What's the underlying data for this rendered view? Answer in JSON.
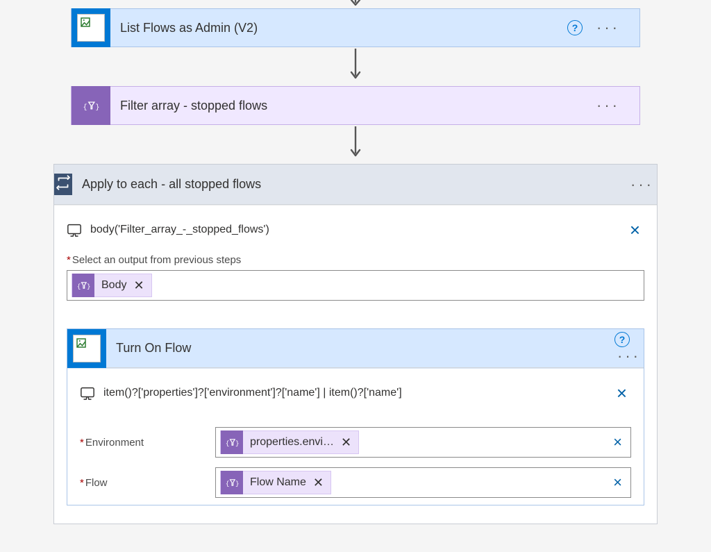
{
  "step_list_flows": {
    "title": "List Flows as Admin (V2)"
  },
  "step_filter": {
    "title": "Filter array - stopped flows"
  },
  "apply_each": {
    "title": "Apply to each - all stopped flows",
    "peek_code": "body('Filter_array_-_stopped_flows')",
    "select_label": "Select an output from previous steps",
    "select_token": "Body"
  },
  "turn_on": {
    "title": "Turn On Flow",
    "peek_code": "item()?['properties']?['environment']?['name'] | item()?['name']",
    "fields": {
      "environment": {
        "label": "Environment",
        "token": "properties.envi…"
      },
      "flow": {
        "label": "Flow",
        "token": "Flow Name"
      }
    }
  },
  "glyphs": {
    "asterisk": "*",
    "help": "?",
    "more": "···",
    "x": "✕",
    "thin_x": "×"
  }
}
